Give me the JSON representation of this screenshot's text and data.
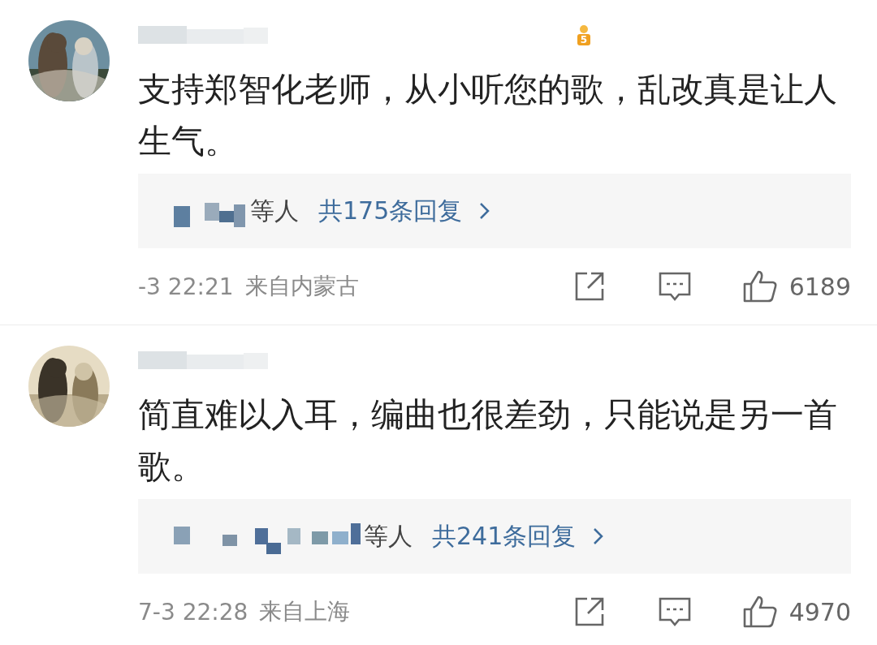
{
  "comments": [
    {
      "badge": "5",
      "text": "支持郑智化老师，从小听您的歌，乱改真是让人生气。",
      "replies": {
        "suffix": "等人",
        "count": "共175条回复"
      },
      "time": "-3 22:21",
      "location": "来自内蒙古",
      "likes": "6189"
    },
    {
      "text": "简直难以入耳，编曲也很差劲，只能说是另一首歌。",
      "replies": {
        "suffix": "等人",
        "count": "共241条回复"
      },
      "time": "7-3 22:28",
      "location": "来自上海",
      "likes": "4970"
    }
  ]
}
